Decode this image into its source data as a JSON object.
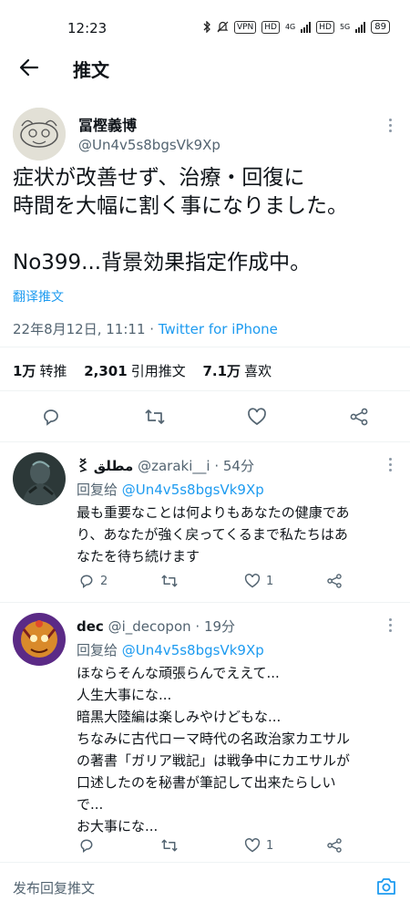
{
  "status_bar": {
    "time": "12:23",
    "vpn": "VPN",
    "hd1": "HD",
    "net1": "4G",
    "hd2": "HD",
    "net2": "5G",
    "battery": "89"
  },
  "header": {
    "title": "推文"
  },
  "main_tweet": {
    "author_name": "冨樫義博",
    "author_handle": "@Un4v5s8bgsVk9Xp",
    "text_lines": [
      "症状が改善せず、治療・回復に",
      "時間を大幅に割く事になりました。",
      "",
      "No399...背景効果指定作成中。"
    ],
    "translate": "翻译推文",
    "date": "22年8月12日, 11:11 · ",
    "source": "Twitter for iPhone",
    "stats": {
      "retweets": "1万",
      "retweets_label": "转推",
      "quotes": "2,301",
      "quotes_label": "引用推文",
      "likes": "7.1万",
      "likes_label": "喜欢"
    }
  },
  "replies": [
    {
      "name": "مطلق",
      "handle": "@zaraki__i",
      "time": " · 54分",
      "reply_to_label": "回复给 ",
      "reply_to": "@Un4v5s8bgsVk9Xp",
      "lines": [
        "最も重要なことは何よりもあなたの健康であ",
        "り、あなたが強く戻ってくるまで私たちはあ",
        "なたを待ち続けます"
      ],
      "reply_count": "2",
      "like_count": "1"
    },
    {
      "name": "dec",
      "handle": "@i_decopon",
      "time": " · 19分",
      "reply_to_label": "回复给 ",
      "reply_to": "@Un4v5s8bgsVk9Xp",
      "lines": [
        "ほならそんな頑張らんでええて...",
        "人生大事にな...",
        "暗黒大陸編は楽しみやけどもな...",
        "ちなみに古代ローマ時代の名政治家カエサル",
        "の著書「ガリア戦記」は戦争中にカエサルが",
        "口述したのを秘書が筆記して出来たらしい",
        "で...",
        "お大事にな..."
      ],
      "reply_count": "",
      "like_count": "1"
    }
  ],
  "compose": {
    "placeholder": "发布回复推文"
  },
  "colors": {
    "accent": "#1d9bf0",
    "secondary": "#536471",
    "text": "#0f1419"
  }
}
